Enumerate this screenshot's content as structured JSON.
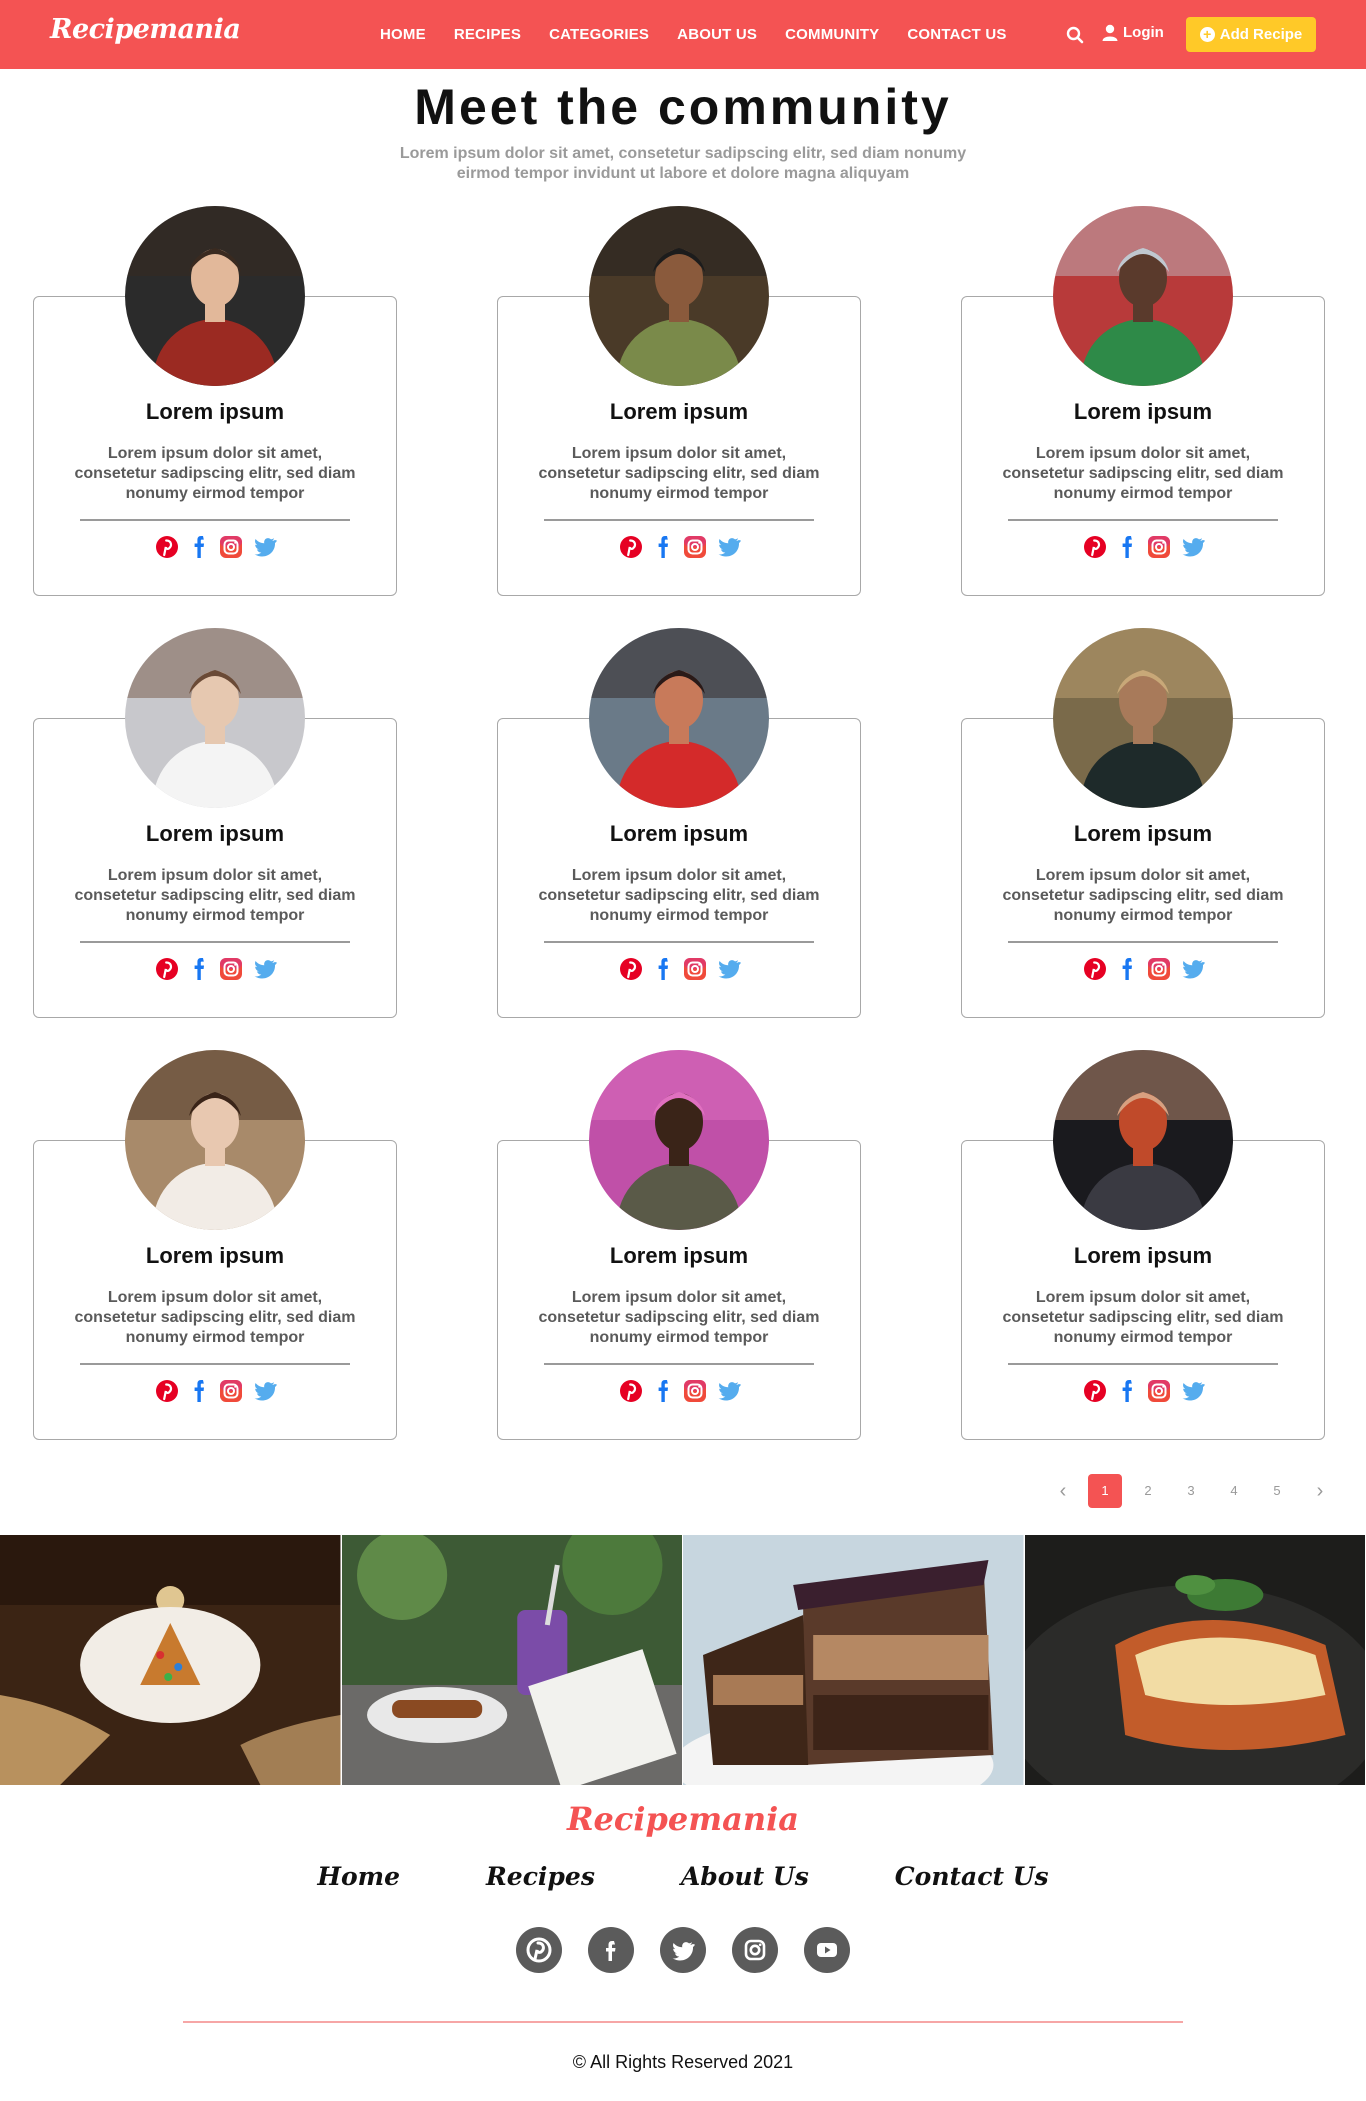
{
  "brand": {
    "logo": "Recipemania",
    "accent": "#f45353",
    "cta_color": "#ffc928"
  },
  "nav": {
    "links": [
      "HOME",
      "RECIPES",
      "CATEGORIES",
      "ABOUT US",
      "COMMUNITY",
      "CONTACT US"
    ],
    "search_icon": "search-icon",
    "login_label": "Login",
    "add_recipe_label": "Add Recipe"
  },
  "header": {
    "title": "Meet the community",
    "subtitle": "Lorem ipsum dolor sit amet, consetetur sadipscing elitr, sed diam nonumy eirmod tempor invidunt ut labore et dolore magna aliquyam"
  },
  "members": [
    {
      "name": "Lorem ipsum",
      "desc": "Lorem ipsum dolor sit amet, consetetur sadipscing elitr, sed diam nonumy eirmod tempor"
    },
    {
      "name": "Lorem ipsum",
      "desc": "Lorem ipsum dolor sit amet, consetetur sadipscing elitr, sed diam nonumy eirmod tempor"
    },
    {
      "name": "Lorem ipsum",
      "desc": "Lorem ipsum dolor sit amet, consetetur sadipscing elitr, sed diam nonumy eirmod tempor"
    },
    {
      "name": "Lorem ipsum",
      "desc": "Lorem ipsum dolor sit amet, consetetur sadipscing elitr, sed diam nonumy eirmod tempor"
    },
    {
      "name": "Lorem ipsum",
      "desc": "Lorem ipsum dolor sit amet, consetetur sadipscing elitr, sed diam nonumy eirmod tempor"
    },
    {
      "name": "Lorem ipsum",
      "desc": "Lorem ipsum dolor sit amet, consetetur sadipscing elitr, sed diam nonumy eirmod tempor"
    },
    {
      "name": "Lorem ipsum",
      "desc": "Lorem ipsum dolor sit amet, consetetur sadipscing elitr, sed diam nonumy eirmod tempor"
    },
    {
      "name": "Lorem ipsum",
      "desc": "Lorem ipsum dolor sit amet, consetetur sadipscing elitr, sed diam nonumy eirmod tempor"
    },
    {
      "name": "Lorem ipsum",
      "desc": "Lorem ipsum dolor sit amet, consetetur sadipscing elitr, sed diam nonumy eirmod tempor"
    }
  ],
  "card_socials": [
    "pinterest-icon",
    "facebook-icon",
    "instagram-icon",
    "twitter-icon"
  ],
  "pagination": {
    "pages": [
      "1",
      "2",
      "3",
      "4",
      "5"
    ],
    "current": "1",
    "prev_icon": "chevron-left-icon",
    "next_icon": "chevron-right-icon"
  },
  "gallery": [
    "gingerbread-cookie-plate",
    "smoothie-and-menu",
    "chocolate-layer-cake",
    "lasagna-plate"
  ],
  "footer": {
    "logo": "Recipemania",
    "links": [
      "Home",
      "Recipes",
      "About Us",
      "Contact Us"
    ],
    "socials": [
      "pinterest-icon",
      "facebook-icon",
      "twitter-icon",
      "instagram-icon",
      "youtube-icon"
    ],
    "copyright": "© All Rights Reserved 2021"
  }
}
